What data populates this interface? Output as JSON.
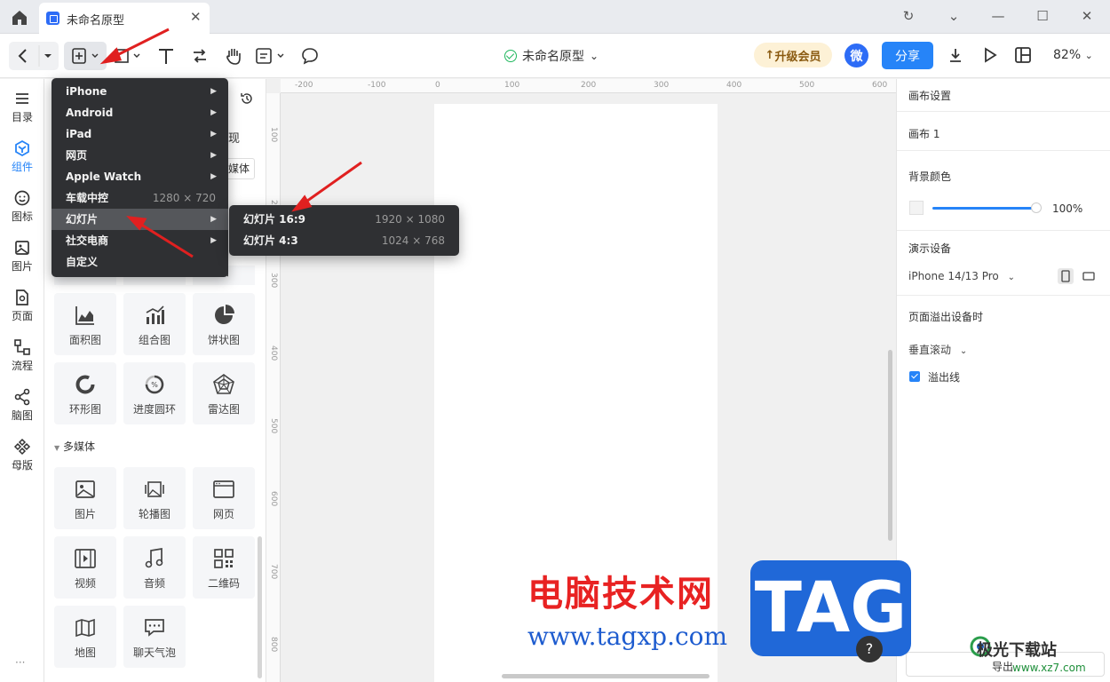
{
  "tab": {
    "title": "未命名原型"
  },
  "toolbar": {
    "doc_title": "未命名原型",
    "upgrade_label": "升级会员",
    "avatar_label": "微",
    "share_label": "分享",
    "zoom_label": "82%"
  },
  "leftnav": {
    "items": [
      {
        "label": "目录",
        "icon": "list-icon"
      },
      {
        "label": "组件",
        "icon": "component-icon"
      },
      {
        "label": "图标",
        "icon": "smile-icon"
      },
      {
        "label": "图片",
        "icon": "image-icon"
      },
      {
        "label": "页面",
        "icon": "page-icon"
      },
      {
        "label": "流程",
        "icon": "flow-icon"
      },
      {
        "label": "脑图",
        "icon": "mindmap-icon"
      },
      {
        "label": "母版",
        "icon": "master-icon"
      }
    ],
    "active": "组件"
  },
  "panel": {
    "partial_texts": {
      "tab_fragment": "现",
      "chip_fragment": "媒体",
      "tile_fragment": "图"
    },
    "chart_components": [
      {
        "label": "面积图"
      },
      {
        "label": "组合图"
      },
      {
        "label": "饼状图"
      },
      {
        "label": "环形图"
      },
      {
        "label": "进度圆环"
      },
      {
        "label": "雷达图"
      }
    ],
    "media_section_title": "多媒体",
    "media_components": [
      {
        "label": "图片"
      },
      {
        "label": "轮播图"
      },
      {
        "label": "网页"
      },
      {
        "label": "视频"
      },
      {
        "label": "音频"
      },
      {
        "label": "二维码"
      },
      {
        "label": "地图"
      },
      {
        "label": "聊天气泡"
      }
    ]
  },
  "ruler": {
    "top": [
      "-200",
      "-100",
      "0",
      "100",
      "200",
      "300",
      "400",
      "500",
      "600"
    ],
    "left": [
      "100",
      "200",
      "300",
      "400",
      "500",
      "600",
      "700",
      "800"
    ]
  },
  "menu": {
    "items": [
      {
        "label": "iPhone",
        "submenu": true
      },
      {
        "label": "Android",
        "submenu": true
      },
      {
        "label": "iPad",
        "submenu": true
      },
      {
        "label": "网页",
        "submenu": true
      },
      {
        "label": "Apple Watch",
        "submenu": true
      },
      {
        "label": "车载中控",
        "dim": "1280 × 720"
      },
      {
        "label": "幻灯片",
        "submenu": true,
        "highlighted": true
      },
      {
        "label": "社交电商",
        "submenu": true
      },
      {
        "label": "自定义"
      }
    ],
    "submenu_items": [
      {
        "label": "幻灯片 16:9",
        "dim": "1920 × 1080"
      },
      {
        "label": "幻灯片 4:3",
        "dim": "1024 × 768"
      }
    ]
  },
  "right_panel": {
    "canvas_settings": "画布设置",
    "canvas_name": "画布 1",
    "bg_color_label": "背景颜色",
    "opacity_value": "100%",
    "opacity_fraction": 1.0,
    "device_label": "演示设备",
    "device_value": "iPhone 14/13 Pro",
    "overflow_label": "页面溢出设备时",
    "scroll_value": "垂直滚动",
    "overflow_line_label": "溢出线",
    "overflow_line_checked": true,
    "export_label": "导出"
  },
  "watermark": {
    "cn": "电脑技术网",
    "url": "www.tagxp.com",
    "tag": "TAG",
    "jg": "极光下载站",
    "jg_url": "www.xz7.com"
  },
  "help_label": "?",
  "colors": {
    "accent": "#2684f8",
    "check": "#1eb75c",
    "arrow": "#e02020",
    "menu_bg": "#2f3033"
  }
}
